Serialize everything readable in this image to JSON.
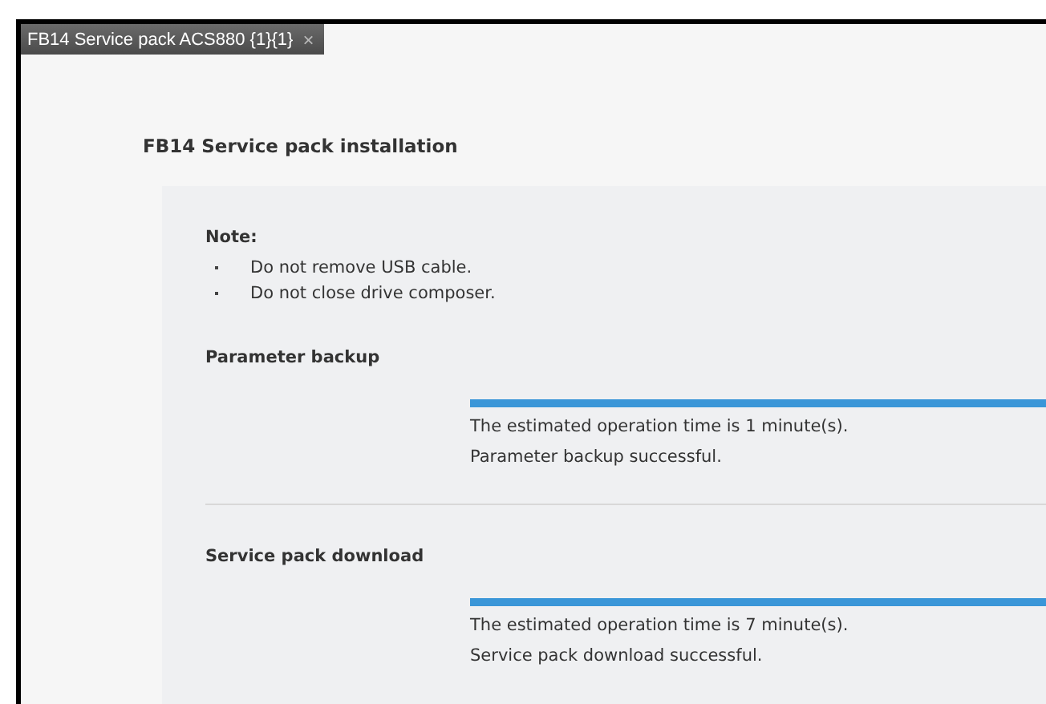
{
  "tab": {
    "label": "FB14 Service pack ACS880 {1}{1}",
    "close": "×"
  },
  "title": "FB14 Service pack installation",
  "note": {
    "heading": "Note:",
    "items": [
      "Do not remove USB cable.",
      "Do not close drive composer."
    ]
  },
  "steps": [
    {
      "name": "Parameter backup",
      "level": 1,
      "estimate": "The estimated operation time is 1 minute(s).",
      "status": "Parameter backup successful."
    },
    {
      "name": "Service pack download",
      "level": 1,
      "estimate": "The estimated operation time is 7 minute(s).",
      "status": "Service pack download successful."
    }
  ]
}
